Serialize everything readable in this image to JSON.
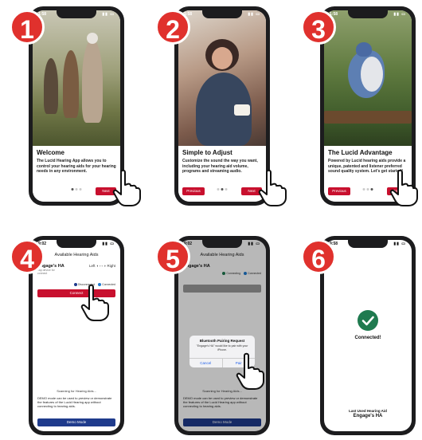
{
  "colors": {
    "badge": "#e0312d",
    "primary_red": "#c8102e",
    "demo_blue": "#1f3b8c",
    "check_green": "#1f7a4f"
  },
  "steps": [
    {
      "number": "1",
      "time": "1:58",
      "title": "Welcome",
      "body": "The Lucid Hearing App allows you to control your hearing aids for your hearing needs in any environment.",
      "next_label": "Next"
    },
    {
      "number": "2",
      "time": "1:58",
      "title": "Simple to Adjust",
      "body": "Customize the sound the way you want, including your hearing aid volume, programs and streaming audio.",
      "prev_label": "Previous",
      "next_label": "Next"
    },
    {
      "number": "3",
      "time": "1:58",
      "title": "The Lucid Advantage",
      "body": "Powered by Lucid hearing aids provide a unique, patented and listener preferred sound quality system. Let's get started!",
      "prev_label": "Previous",
      "next_label": "Next"
    },
    {
      "number": "4",
      "time": "9:02",
      "nav_title": "Available Hearing Aids",
      "device_name": "Engage's HA",
      "device_sub": "Tap device for connect",
      "left_label": "Left",
      "right_label": "Right",
      "legend_disconnected": "Disconnected",
      "legend_connected": "Connected",
      "connect_label": "Connect",
      "scanning": "Scanning for Hearing Aids...",
      "demo_text": "DEMO mode can be used to preview or demonstrate the features of the Lucid Hearing app without connecting to hearing aids.",
      "demo_label": "Demo Mode"
    },
    {
      "number": "5",
      "time": "9:02",
      "nav_title": "Available Hearing Aids",
      "device_name": "Engage's HA",
      "legend_connecting": "Connecting",
      "legend_connected": "Connected",
      "alert_title": "Bluetooth Pairing Request",
      "alert_msg": "\"Engage's HA\" would like to pair with your iPhone.",
      "cancel_label": "Cancel",
      "pair_label": "Pair",
      "scanning": "Scanning for Hearing Aids...",
      "demo_text": "DEMO mode can be used to preview or demonstrate the features of the Lucid Hearing app without connecting to hearing aids.",
      "demo_label": "Demo Mode"
    },
    {
      "number": "6",
      "time": "9:58",
      "connected_label": "Connected!",
      "last_used_label": "Last Used Hearing Aid",
      "last_used_name": "Engage's HA"
    }
  ]
}
